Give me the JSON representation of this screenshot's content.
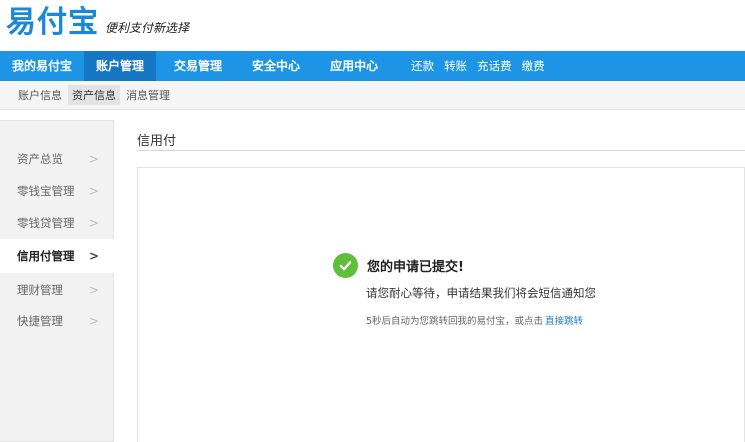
{
  "logo": {
    "main": "易付宝",
    "slogan": "便利支付新选择"
  },
  "nav": {
    "items": [
      {
        "label": "我的易付宝"
      },
      {
        "label": "账户管理"
      },
      {
        "label": "交易管理"
      },
      {
        "label": "安全中心"
      },
      {
        "label": "应用中心"
      }
    ],
    "quick_links": [
      {
        "label": "还款"
      },
      {
        "label": "转账"
      },
      {
        "label": "充话费"
      },
      {
        "label": "缴费"
      }
    ]
  },
  "subnav": {
    "items": [
      {
        "label": "账户信息"
      },
      {
        "label": "资产信息"
      },
      {
        "label": "消息管理"
      }
    ]
  },
  "sidebar": {
    "items": [
      {
        "label": "资产总览"
      },
      {
        "label": "零钱宝管理"
      },
      {
        "label": "零钱贷管理"
      },
      {
        "label": "信用付管理"
      },
      {
        "label": "理财管理"
      },
      {
        "label": "快捷管理"
      }
    ],
    "chevron": ">"
  },
  "main": {
    "title": "信用付",
    "success_title": "您的申请已提交!",
    "success_desc": "请您耐心等待，申请结果我们将会短信通知您",
    "redirect_text": "5秒后自动为您跳转回我的易付宝，或点击",
    "redirect_link": "直接跳转"
  },
  "colors": {
    "nav_bg": "#1d94e6",
    "nav_active": "#1577c4",
    "logo": "#1a88d8",
    "success": "#5fbe3a",
    "link": "#1a7ad4"
  }
}
